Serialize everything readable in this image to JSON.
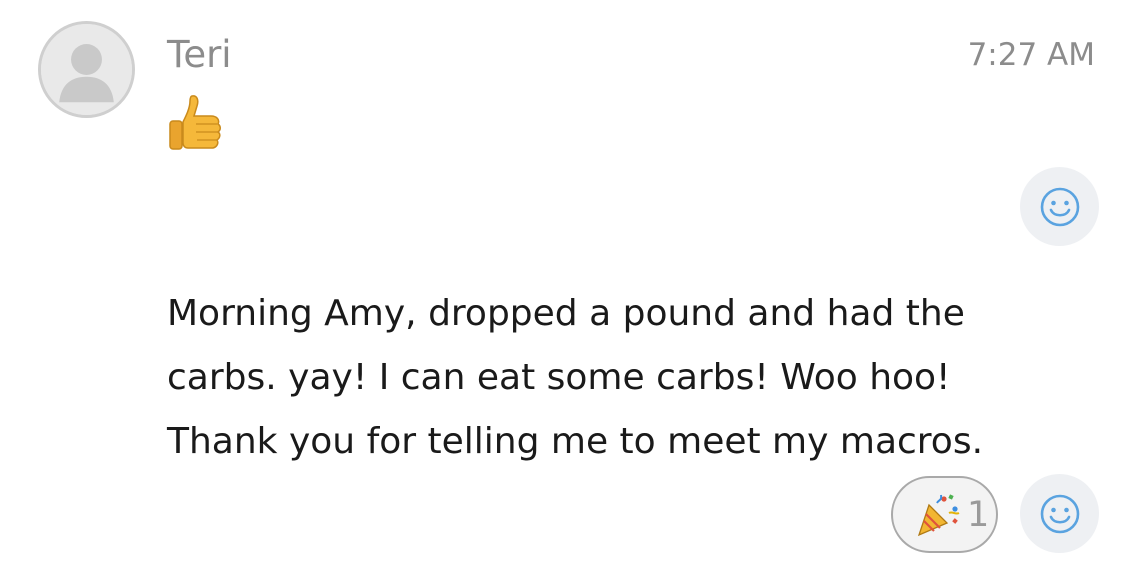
{
  "message_thread": {
    "sender": {
      "name": "Teri",
      "avatar_icon": "default-avatar-silhouette"
    },
    "timestamp": "7:27 AM",
    "messages": [
      {
        "type": "emoji",
        "icon": "thumbs-up-emoji",
        "react_button_icon": "smiley-face-icon"
      },
      {
        "type": "text",
        "text": "Morning Amy, dropped a pound and had the\ncarbs.  yay! I can eat some carbs!  Woo hoo!\nThank you for telling me to meet my macros.",
        "reaction": {
          "icon": "party-popper-emoji",
          "count": "1"
        },
        "react_button_icon": "smiley-face-icon"
      }
    ]
  },
  "colors": {
    "secondary_text": "#8c8c8c",
    "body_text": "#1a1a1a",
    "react_icon_blue": "#5aa3e0",
    "react_button_bg": "#eef0f3"
  }
}
